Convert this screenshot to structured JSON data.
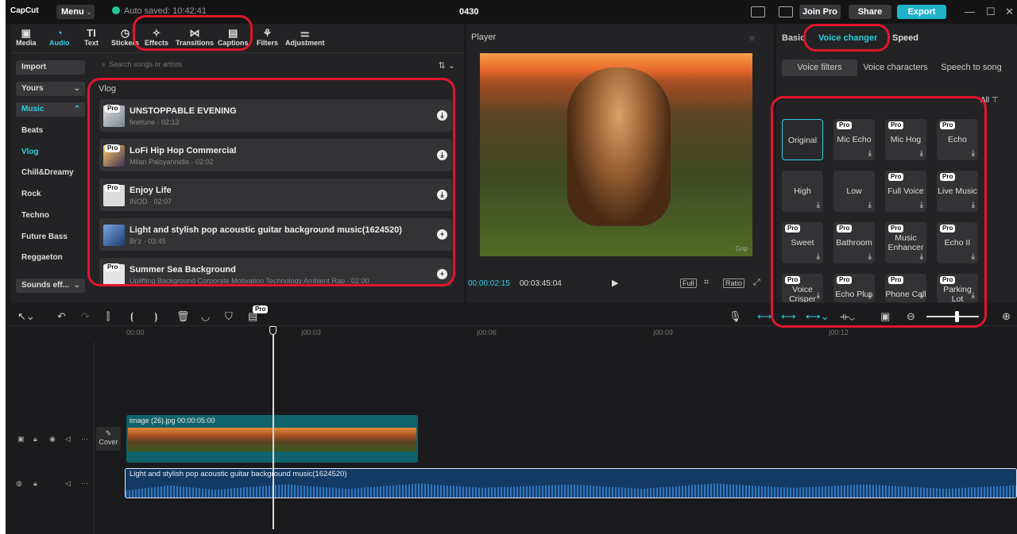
{
  "app": {
    "logo": "CapCut",
    "menu": "Menu",
    "saved": "Auto saved: 10:42:41",
    "project": "0430",
    "join_pro": "Join Pro",
    "share": "Share",
    "export": "Export"
  },
  "tools": [
    {
      "label": "Media",
      "icon": "▣"
    },
    {
      "label": "Audio",
      "icon": "◔"
    },
    {
      "label": "Text",
      "icon": "TI"
    },
    {
      "label": "Stickers",
      "icon": "◷"
    },
    {
      "label": "Effects",
      "icon": "✧"
    },
    {
      "label": "Transitions",
      "icon": "⋈"
    },
    {
      "label": "Captions",
      "icon": "▤"
    },
    {
      "label": "Filters",
      "icon": "⚘"
    },
    {
      "label": "Adjustment",
      "icon": "⚌"
    }
  ],
  "sidebar": {
    "import": "Import",
    "yours": "Yours",
    "music": "Music",
    "items": [
      "Beats",
      "Vlog",
      "Chill&Dreamy",
      "Rock",
      "Techno",
      "Future Bass",
      "Reggaeton"
    ],
    "sounds": "Sounds eff..."
  },
  "search": {
    "placeholder": "Search songs or artists"
  },
  "section_title": "Vlog",
  "tracks": [
    {
      "title": "UNSTOPPABLE EVENING",
      "sub": "finetune · 02:13",
      "pro": "Pro"
    },
    {
      "title": "LoFi Hip Hop Commercial",
      "sub": "Milan Paloyannidis · 02:02",
      "pro": "Pro"
    },
    {
      "title": "Enjoy Life",
      "sub": "INOD · 02:07",
      "pro": "Pro"
    },
    {
      "title": "Light and stylish pop acoustic guitar background music(1624520)",
      "sub": "Br'z · 03:45",
      "pro": ""
    },
    {
      "title": "Summer Sea Background",
      "sub": "Uplifting Background Corporate Motivation Technology Ambient Rap · 02:00",
      "pro": "Pro"
    }
  ],
  "player": {
    "title": "Player",
    "current": "00:00:02:15",
    "total": "00:03:45:04",
    "full": "Full",
    "ratio": "Ratio",
    "watermark": "Gnp"
  },
  "right_tabs": {
    "basic": "Basic",
    "voice_changer": "Voice changer",
    "speed": "Speed"
  },
  "voice_subtabs": [
    "Voice filters",
    "Voice characters",
    "Speech to song"
  ],
  "filter_all": "All",
  "voices": [
    {
      "label": "Original",
      "pro": ""
    },
    {
      "label": "Mic Echo",
      "pro": "Pro"
    },
    {
      "label": "Mic Hog",
      "pro": "Pro"
    },
    {
      "label": "Echo",
      "pro": "Pro"
    },
    {
      "label": "High",
      "pro": ""
    },
    {
      "label": "Low",
      "pro": ""
    },
    {
      "label": "Full Voice",
      "pro": "Pro"
    },
    {
      "label": "Live Music",
      "pro": "Pro"
    },
    {
      "label": "Sweet",
      "pro": "Pro"
    },
    {
      "label": "Bathroom",
      "pro": "Pro"
    },
    {
      "label": "Music Enhancer",
      "pro": "Pro"
    },
    {
      "label": "Echo II",
      "pro": "Pro"
    },
    {
      "label": "Voice Crisper",
      "pro": "Pro"
    },
    {
      "label": "Echo Plus",
      "pro": "Pro"
    },
    {
      "label": "Phone Call",
      "pro": "Pro"
    },
    {
      "label": "Parking Lot",
      "pro": "Pro"
    }
  ],
  "timeline": {
    "pro_badge": "Pro",
    "ticks": [
      "00:00",
      "|00:03",
      "|00:06",
      "|00:09",
      "|00:12"
    ],
    "video_clip": "image (26).jpg  00:00:05:00",
    "cover": "Cover",
    "audio_clip": "Light and stylish pop acoustic guitar background music(1624520)"
  },
  "colors": {
    "accent": "#2fd0e0",
    "highlight": "#e0162c",
    "panel": "#232325"
  }
}
